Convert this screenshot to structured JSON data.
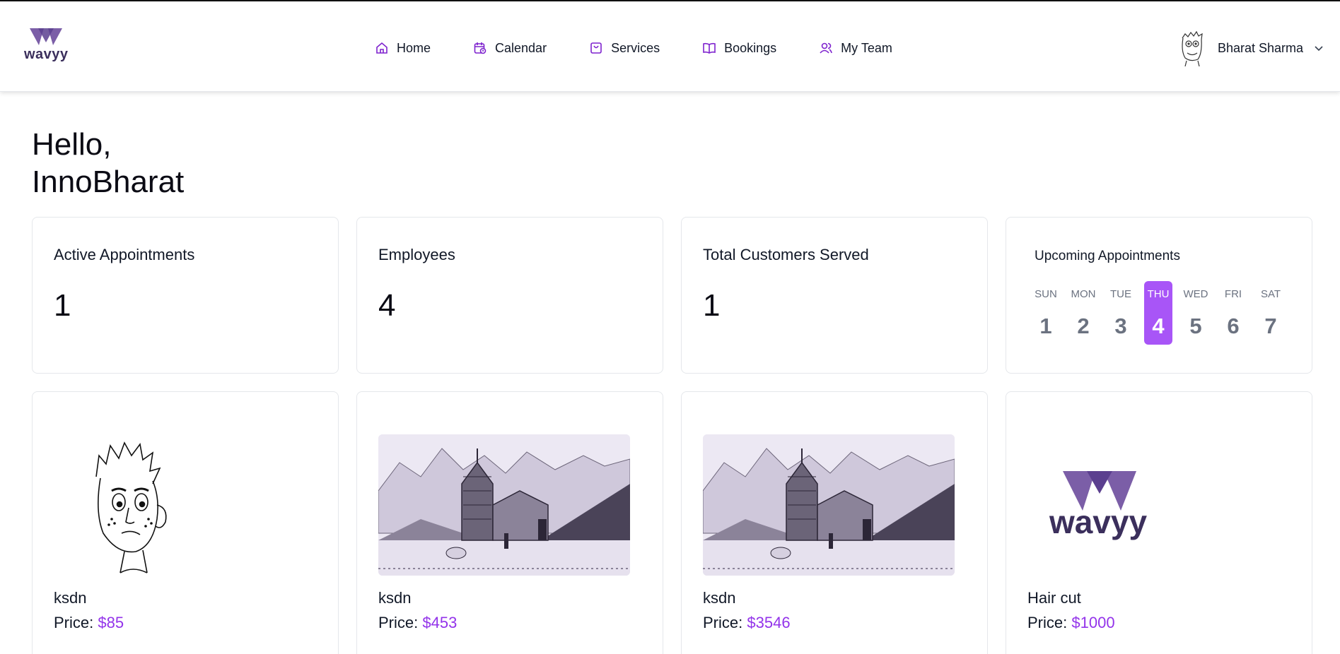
{
  "header": {
    "logo_text": "wavyy",
    "nav": [
      {
        "label": "Home",
        "icon": "home-icon"
      },
      {
        "label": "Calendar",
        "icon": "calendar-icon"
      },
      {
        "label": "Services",
        "icon": "bag-icon"
      },
      {
        "label": "Bookings",
        "icon": "book-icon"
      },
      {
        "label": "My Team",
        "icon": "team-icon"
      }
    ],
    "user_name": "Bharat Sharma"
  },
  "greeting": {
    "line1": "Hello,",
    "line2": "InnoBharat"
  },
  "stats": [
    {
      "title": "Active Appointments",
      "value": "1"
    },
    {
      "title": "Employees",
      "value": "4"
    },
    {
      "title": "Total Customers Served",
      "value": "1"
    }
  ],
  "upcoming": {
    "title": "Upcoming Appointments",
    "days": [
      {
        "name": "SUN",
        "date": "1"
      },
      {
        "name": "MON",
        "date": "2"
      },
      {
        "name": "TUE",
        "date": "3"
      },
      {
        "name": "THU",
        "date": "4",
        "active": true
      },
      {
        "name": "WED",
        "date": "5"
      },
      {
        "name": "FRI",
        "date": "6"
      },
      {
        "name": "SAT",
        "date": "7"
      }
    ]
  },
  "services": [
    {
      "name": "ksdn",
      "price_label": "Price:",
      "price": "$85",
      "image": "cartoon-face"
    },
    {
      "name": "ksdn",
      "price_label": "Price:",
      "price": "$453",
      "image": "temple-sketch"
    },
    {
      "name": "ksdn",
      "price_label": "Price:",
      "price": "$3546",
      "image": "temple-sketch"
    },
    {
      "name": "Hair cut",
      "price_label": "Price:",
      "price": "$1000",
      "image": "wavyy-logo",
      "logo_text": "wavyy"
    }
  ],
  "colors": {
    "accent": "#a855f7",
    "price": "#9333ea",
    "logo": "#7b5ea7",
    "logo_text": "#3b2f5c"
  }
}
